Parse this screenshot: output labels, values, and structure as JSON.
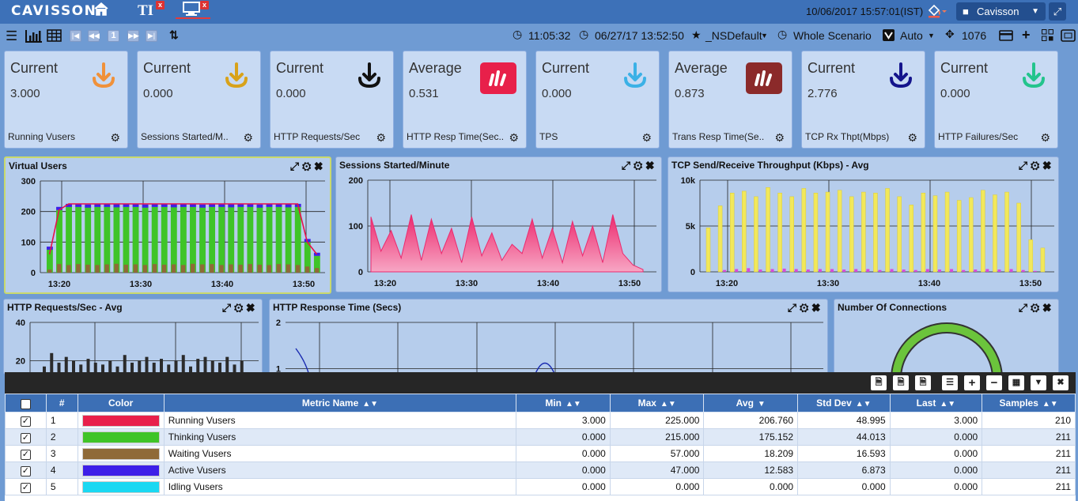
{
  "header": {
    "logo": "CAVISSON",
    "datetime": "10/06/2017 15:57:01(IST)",
    "user": "Cavisson"
  },
  "toolbar": {
    "page_number": "1",
    "elapsed_time": "11:05:32",
    "start_time": "06/27/17 13:52:50",
    "favorite": "_NSDefault",
    "scenario": "Whole Scenario",
    "mode": "Auto",
    "count": "1076"
  },
  "cards": [
    {
      "label": "Current",
      "value": "3.000",
      "name": "Running Vusers",
      "icon": "download-arrow-icon",
      "color": "#f0913a"
    },
    {
      "label": "Current",
      "value": "0.000",
      "name": "Sessions Started/M..",
      "icon": "download-arrow-icon",
      "color": "#d8a21a"
    },
    {
      "label": "Current",
      "value": "0.000",
      "name": "HTTP Requests/Sec",
      "icon": "download-arrow-icon",
      "color": "#111111"
    },
    {
      "label": "Average",
      "value": "0.531",
      "name": "HTTP Resp Time(Sec..",
      "icon": "bar-chart-icon",
      "color": "#e8204a"
    },
    {
      "label": "Current",
      "value": "0.000",
      "name": "TPS",
      "icon": "download-arrow-icon",
      "color": "#3bb1e6"
    },
    {
      "label": "Average",
      "value": "0.873",
      "name": "Trans Resp Time(Se..",
      "icon": "bar-chart-icon",
      "color": "#8b2a2a"
    },
    {
      "label": "Current",
      "value": "2.776",
      "name": "TCP Rx Thpt(Mbps)",
      "icon": "download-arrow-icon",
      "color": "#14148c"
    },
    {
      "label": "Current",
      "value": "0.000",
      "name": "HTTP Failures/Sec",
      "icon": "download-arrow-icon",
      "color": "#23c48c"
    }
  ],
  "panels": {
    "virtual_users": "Virtual Users",
    "sessions": "Sessions Started/Minute",
    "tcp": "TCP Send/Receive Throughput (Kbps) - Avg",
    "http_req": "HTTP Requests/Sec - Avg",
    "http_resp": "HTTP Response Time (Secs)",
    "connections": "Number Of Connections"
  },
  "chart_data": [
    {
      "type": "bar",
      "title": "Virtual Users",
      "x_ticks": [
        "13:20",
        "13:30",
        "13:40",
        "13:50"
      ],
      "y_ticks": [
        "0",
        "100",
        "200",
        "300"
      ],
      "ylim": [
        0,
        300
      ],
      "series": [
        {
          "name": "Thinking Vusers",
          "color": "#3fc428",
          "values": [
            75,
            205,
            215,
            215,
            215,
            215,
            215,
            215,
            215,
            215,
            215,
            215,
            215,
            215,
            215,
            215,
            215,
            215,
            215,
            215,
            215,
            215,
            215,
            215,
            215,
            215,
            215,
            100,
            55
          ]
        },
        {
          "name": "Waiting Vusers",
          "color": "#8f6a38",
          "values": [
            10,
            28,
            25,
            28,
            26,
            25,
            27,
            29,
            26,
            27,
            25,
            28,
            26,
            27,
            25,
            29,
            27,
            28,
            25,
            27,
            26,
            28,
            26,
            25,
            28,
            27,
            25,
            20,
            15
          ]
        },
        {
          "name": "Active Vusers",
          "color": "#3d1fe8",
          "values": [
            80,
            210,
            220,
            220,
            218,
            220,
            220,
            219,
            220,
            220,
            218,
            220,
            220,
            219,
            220,
            220,
            218,
            220,
            220,
            219,
            220,
            220,
            218,
            220,
            220,
            219,
            220,
            105,
            60
          ]
        },
        {
          "name": "Running Vusers",
          "color": "#e8104a",
          "type": "line",
          "values": [
            60,
            205,
            225,
            225,
            225,
            225,
            225,
            225,
            225,
            225,
            225,
            225,
            225,
            225,
            225,
            225,
            225,
            225,
            225,
            225,
            225,
            225,
            225,
            225,
            225,
            225,
            225,
            100,
            60
          ]
        }
      ]
    },
    {
      "type": "area",
      "title": "Sessions Started/Minute",
      "x_ticks": [
        "13:20",
        "13:30",
        "13:40",
        "13:50"
      ],
      "y_ticks": [
        "0",
        "100",
        "200"
      ],
      "ylim": [
        0,
        200
      ],
      "color": "#ec2a6e",
      "values": [
        120,
        45,
        90,
        30,
        125,
        25,
        115,
        40,
        95,
        20,
        120,
        35,
        85,
        25,
        60,
        40,
        115,
        30,
        95,
        20,
        110,
        35,
        100,
        20,
        125,
        40,
        15,
        5
      ]
    },
    {
      "type": "bar",
      "title": "TCP Send/Receive Throughput (Kbps) - Avg",
      "x_ticks": [
        "13:20",
        "13:30",
        "13:40",
        "13:50"
      ],
      "y_ticks": [
        "0",
        "5k",
        "10k"
      ],
      "ylim": [
        0,
        10000
      ],
      "series": [
        {
          "name": "Receive",
          "color": "#f2e85a",
          "values": [
            4800,
            7200,
            8600,
            8800,
            8200,
            9200,
            8600,
            8200,
            9100,
            8600,
            8700,
            8900,
            8200,
            8700,
            8600,
            9100,
            8200,
            7300,
            8600,
            8300,
            8700,
            7800,
            8100,
            8900,
            8400,
            8700,
            7500,
            3500,
            2600
          ]
        },
        {
          "name": "Send",
          "color": "#d84ad8",
          "values": [
            0,
            200,
            300,
            400,
            250,
            300,
            350,
            300,
            250,
            300,
            300,
            250,
            300,
            300,
            200,
            300,
            250,
            200,
            300,
            250,
            300,
            200,
            250,
            300,
            250,
            300,
            200,
            100,
            0
          ]
        }
      ]
    },
    {
      "type": "bar",
      "title": "HTTP Requests/Sec - Avg",
      "y_ticks": [
        "20",
        "40"
      ],
      "ylim": [
        0,
        40
      ],
      "color": "#2b2b2b",
      "values": [
        17,
        24,
        19,
        22,
        20,
        18,
        21,
        19,
        18,
        20,
        17,
        23,
        19,
        20,
        22,
        19,
        21,
        18,
        20,
        23,
        17,
        21,
        22,
        20,
        19,
        22,
        18,
        20
      ]
    },
    {
      "type": "line",
      "title": "HTTP Response Time (Secs)",
      "y_ticks": [
        "1",
        "2"
      ],
      "ylim": [
        0,
        2
      ],
      "color": "#1a2bb0"
    }
  ],
  "grid": {
    "columns": [
      "#",
      "Color",
      "Metric Name",
      "Min",
      "Max",
      "Avg",
      "Std Dev",
      "Last",
      "Samples"
    ],
    "rows": [
      {
        "num": "1",
        "color": "#e8204a",
        "name": "Running Vusers",
        "min": "3.000",
        "max": "225.000",
        "avg": "206.760",
        "std": "48.995",
        "last": "3.000",
        "samples": "210"
      },
      {
        "num": "2",
        "color": "#3fc428",
        "name": "Thinking Vusers",
        "min": "0.000",
        "max": "215.000",
        "avg": "175.152",
        "std": "44.013",
        "last": "0.000",
        "samples": "211"
      },
      {
        "num": "3",
        "color": "#8f6a38",
        "name": "Waiting Vusers",
        "min": "0.000",
        "max": "57.000",
        "avg": "18.209",
        "std": "16.593",
        "last": "0.000",
        "samples": "211"
      },
      {
        "num": "4",
        "color": "#3d1fe8",
        "name": "Active Vusers",
        "min": "0.000",
        "max": "47.000",
        "avg": "12.583",
        "std": "6.873",
        "last": "0.000",
        "samples": "211"
      },
      {
        "num": "5",
        "color": "#1ad8f2",
        "name": "Idling Vusers",
        "min": "0.000",
        "max": "0.000",
        "avg": "0.000",
        "std": "0.000",
        "last": "0.000",
        "samples": "211"
      }
    ]
  }
}
